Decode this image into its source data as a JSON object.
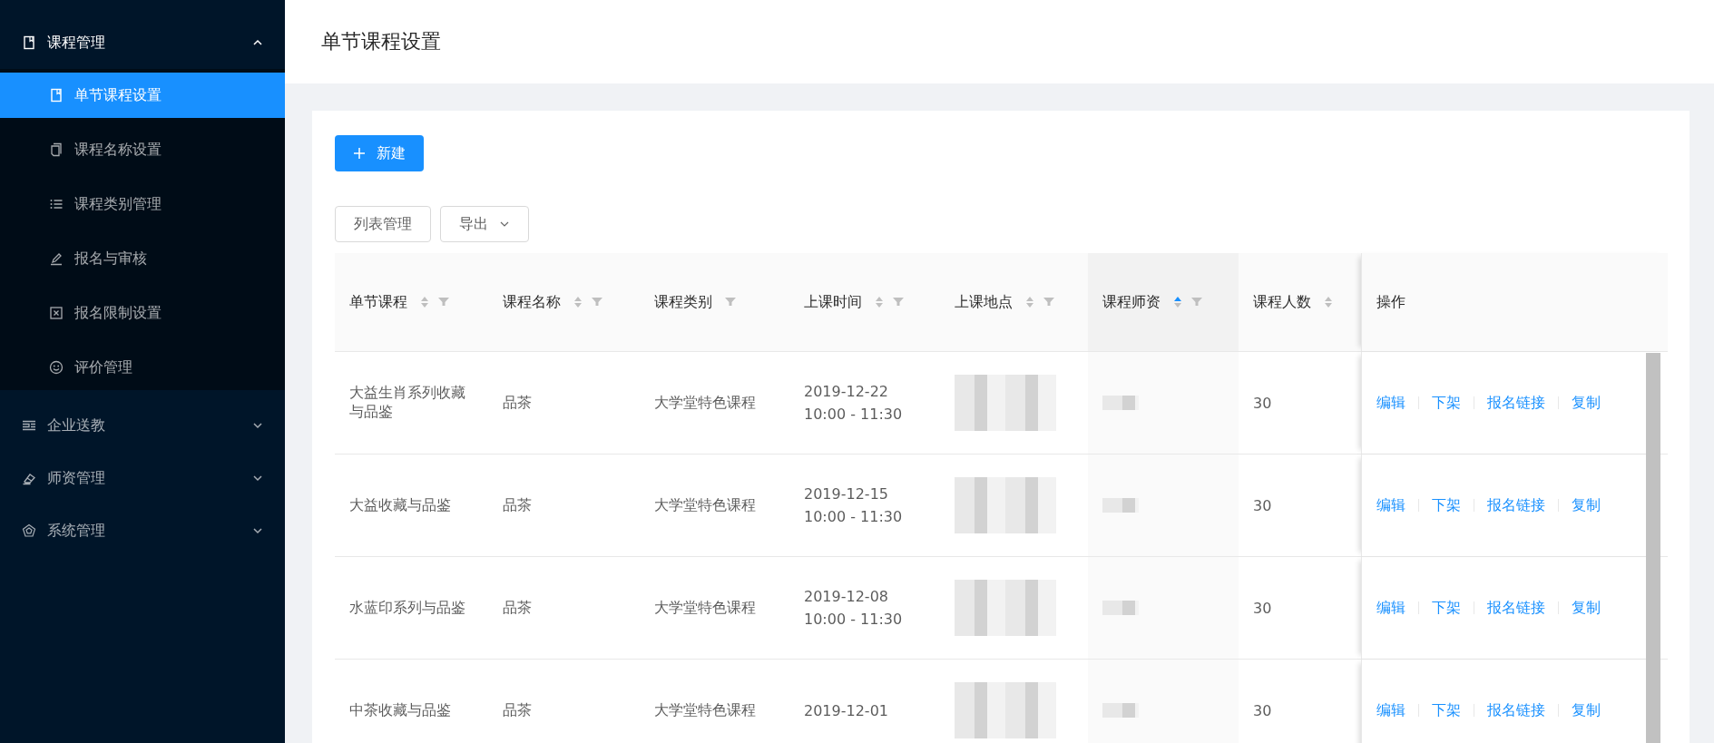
{
  "sidebar": {
    "groups": [
      {
        "label": "课程管理",
        "expanded": true,
        "children": [
          {
            "label": "单节课程设置",
            "selected": true
          },
          {
            "label": "课程名称设置",
            "selected": false
          },
          {
            "label": "课程类别管理",
            "selected": false
          },
          {
            "label": "报名与审核",
            "selected": false
          },
          {
            "label": "报名限制设置",
            "selected": false
          },
          {
            "label": "评价管理",
            "selected": false
          }
        ]
      },
      {
        "label": "企业送教",
        "expanded": false
      },
      {
        "label": "师资管理",
        "expanded": false
      },
      {
        "label": "系统管理",
        "expanded": false
      }
    ]
  },
  "header": {
    "title": "单节课程设置"
  },
  "toolbar": {
    "new_button": "新建",
    "list_button": "列表管理",
    "export_button": "导出"
  },
  "table": {
    "columns": [
      {
        "label": "单节课程",
        "sortable": true,
        "filterable": true,
        "sorted": false
      },
      {
        "label": "课程名称",
        "sortable": true,
        "filterable": true,
        "sorted": false
      },
      {
        "label": "课程类别",
        "sortable": false,
        "filterable": true,
        "sorted": false
      },
      {
        "label": "上课时间",
        "sortable": true,
        "filterable": true,
        "sorted": false
      },
      {
        "label": "上课地点",
        "sortable": true,
        "filterable": true,
        "sorted": false
      },
      {
        "label": "课程师资",
        "sortable": true,
        "filterable": true,
        "sorted": true
      },
      {
        "label": "课程人数",
        "sortable": true,
        "filterable": false,
        "sorted": false
      },
      {
        "label": "操作",
        "sortable": false,
        "filterable": false,
        "sorted": false
      }
    ],
    "rows": [
      {
        "course": "大益生肖系列收藏与品鉴",
        "name": "品茶",
        "category": "大学堂特色课程",
        "date": "2019-12-22",
        "time": "10:00 - 11:30",
        "count": "30",
        "actions": [
          "编辑",
          "下架",
          "报名链接",
          "复制"
        ]
      },
      {
        "course": "大益收藏与品鉴",
        "name": "品茶",
        "category": "大学堂特色课程",
        "date": "2019-12-15",
        "time": "10:00 - 11:30",
        "count": "30",
        "actions": [
          "编辑",
          "下架",
          "报名链接",
          "复制"
        ]
      },
      {
        "course": "水蓝印系列与品鉴",
        "name": "品茶",
        "category": "大学堂特色课程",
        "date": "2019-12-08",
        "time": "10:00 - 11:30",
        "count": "30",
        "actions": [
          "编辑",
          "下架",
          "报名链接",
          "复制"
        ]
      },
      {
        "course": "中茶收藏与品鉴",
        "name": "品茶",
        "category": "大学堂特色课程",
        "date": "2019-12-01",
        "count": "30",
        "actions": [
          "编辑",
          "下架",
          "报名链接",
          "复制"
        ]
      }
    ]
  }
}
